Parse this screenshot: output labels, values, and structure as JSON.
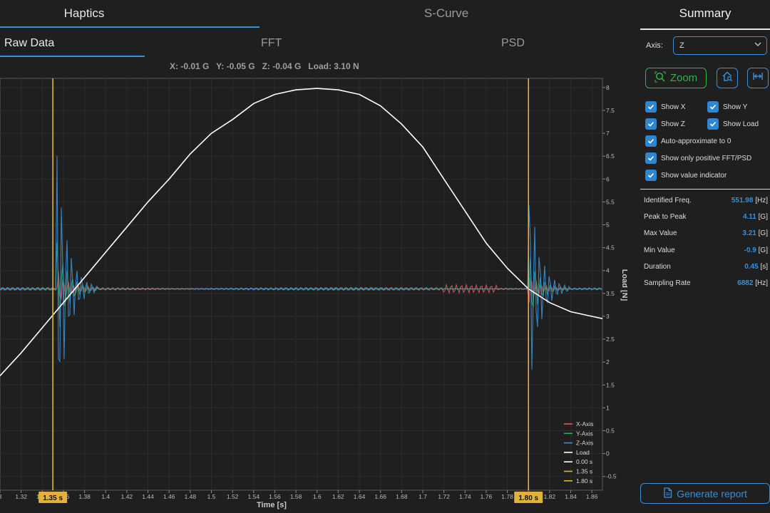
{
  "tabs": {
    "haptics": "Haptics",
    "scurve": "S-Curve",
    "summary": "Summary"
  },
  "subtabs": {
    "raw": "Raw Data",
    "fft": "FFT",
    "psd": "PSD"
  },
  "readout": "X: -0.01 G   Y: -0.05 G   Z: -0.04 G   Load: 3.10 N",
  "controls": {
    "axis_label": "Axis:",
    "axis_value": "Z",
    "zoom_label": "Zoom",
    "checkboxes": {
      "show_x": "Show X",
      "show_y": "Show Y",
      "show_z": "Show Z",
      "show_load": "Show Load",
      "auto_approx": "Auto-approximate to 0",
      "positive_only": "Show only positive FFT/PSD",
      "value_indicator": "Show value indicator"
    },
    "generate_report": "Generate report"
  },
  "stats": [
    {
      "label": "Identified Freq.",
      "value": "551.98",
      "unit": "[Hz]"
    },
    {
      "label": "Peak to Peak",
      "value": "4.11",
      "unit": "[G]"
    },
    {
      "label": "Max Value",
      "value": "3.21",
      "unit": "[G]"
    },
    {
      "label": "Min Value",
      "value": "-0.9",
      "unit": "[G]"
    },
    {
      "label": "Duration",
      "value": "0.45",
      "unit": "[s]"
    },
    {
      "label": "Sampling Rate",
      "value": "6882",
      "unit": "[Hz]"
    }
  ],
  "colors": {
    "accent": "#3a8fd6",
    "green": "#2fb34a",
    "marker": "#e2b13c",
    "x_axis": "#e05555",
    "y_axis": "#2faa6a",
    "z_axis": "#3a8fd6",
    "load": "#ffffff"
  },
  "chart_data": {
    "type": "line",
    "xlabel": "Time [s]",
    "ylabel": "Load [N]",
    "xlim": [
      1.3,
      1.87
    ],
    "ylim": [
      -0.8,
      8.2
    ],
    "x_ticks": [
      "3",
      "1.32",
      "1.34",
      "1.36",
      "1.38",
      "1.4",
      "1.42",
      "1.44",
      "1.46",
      "1.48",
      "1.5",
      "1.52",
      "1.54",
      "1.56",
      "1.58",
      "1.6",
      "1.62",
      "1.64",
      "1.66",
      "1.68",
      "1.7",
      "1.72",
      "1.74",
      "1.76",
      "1.78",
      "1.8",
      "1.82",
      "1.84",
      "1.86"
    ],
    "y_ticks": [
      "8",
      "7.5",
      "7",
      "6.5",
      "6",
      "5.5",
      "5",
      "4.5",
      "4",
      "3.5",
      "3",
      "2.5",
      "2",
      "1.5",
      "1",
      "0.5",
      "0",
      "-0.5"
    ],
    "markers": [
      {
        "x": 1.35,
        "label": "1.35 s"
      },
      {
        "x": 1.8,
        "label": "1.80 s"
      }
    ],
    "legend_position": "bottom-right",
    "legend": [
      "X-Axis",
      "Y-Axis",
      "Z-Axis",
      "Load",
      "0.00 s",
      "1.35 s",
      "1.80 s"
    ],
    "grid": true,
    "load_series": {
      "name": "Load",
      "x": [
        1.3,
        1.32,
        1.34,
        1.36,
        1.38,
        1.4,
        1.42,
        1.44,
        1.46,
        1.48,
        1.5,
        1.52,
        1.54,
        1.56,
        1.58,
        1.6,
        1.62,
        1.64,
        1.66,
        1.68,
        1.7,
        1.72,
        1.74,
        1.76,
        1.78,
        1.8,
        1.82,
        1.84,
        1.86,
        1.87
      ],
      "y": [
        1.7,
        2.2,
        2.75,
        3.3,
        3.85,
        4.4,
        4.95,
        5.5,
        6.0,
        6.55,
        7.0,
        7.3,
        7.65,
        7.85,
        7.95,
        7.98,
        7.95,
        7.85,
        7.6,
        7.2,
        6.7,
        6.0,
        5.3,
        4.6,
        4.05,
        3.6,
        3.3,
        3.1,
        3.0,
        2.95
      ]
    },
    "vibration_baseline": 3.6
  }
}
